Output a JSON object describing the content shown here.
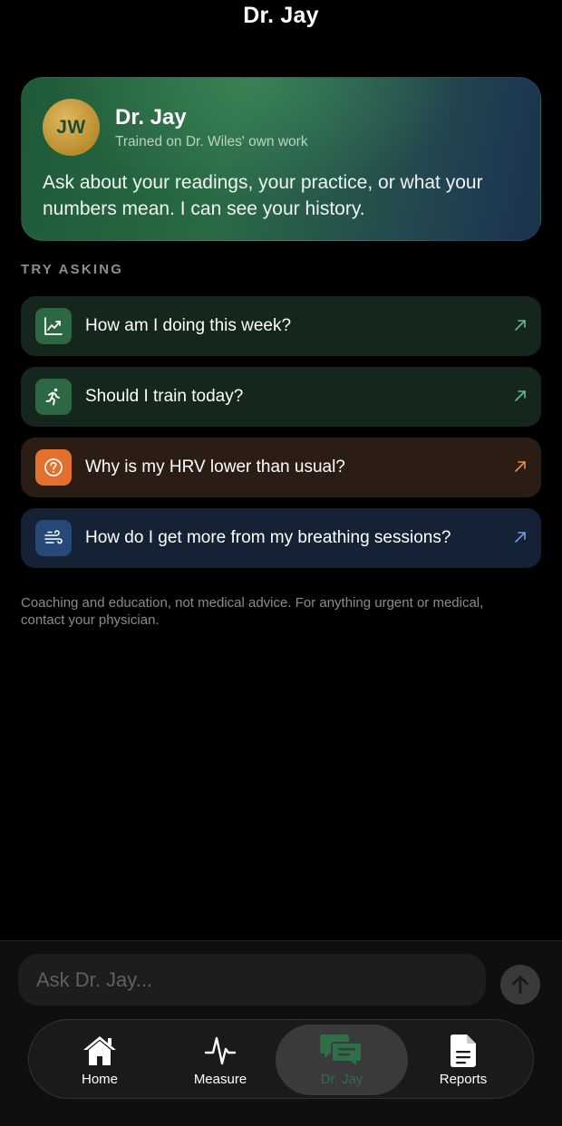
{
  "header": {
    "title": "Dr. Jay"
  },
  "hero": {
    "avatar_initials": "JW",
    "name": "Dr. Jay",
    "subtitle": "Trained on Dr. Wiles' own work",
    "description": "Ask about your readings, your practice, or what your numbers mean. I can see your history."
  },
  "suggestions": {
    "section_label": "TRY ASKING",
    "items": [
      {
        "label": "How am I doing this week?",
        "icon": "trend-chart-icon",
        "theme": "green",
        "accent": "#5bbf86"
      },
      {
        "label": "Should I train today?",
        "icon": "running-figure-icon",
        "theme": "green",
        "accent": "#5bbf86"
      },
      {
        "label": "Why is my HRV lower than usual?",
        "icon": "question-circle-icon",
        "theme": "orange",
        "accent": "#f08a4b"
      },
      {
        "label": "How do I get more from my breathing sessions?",
        "icon": "wind-icon",
        "theme": "blue",
        "accent": "#6f9fe0"
      }
    ]
  },
  "disclaimer": "Coaching and education, not medical advice. For anything urgent or medical, contact your physician.",
  "composer": {
    "placeholder": "Ask Dr. Jay..."
  },
  "tabbar": {
    "tabs": [
      {
        "label": "Home",
        "icon": "house-icon",
        "active": false
      },
      {
        "label": "Measure",
        "icon": "heartbeat-icon",
        "active": false
      },
      {
        "label": "Dr. Jay",
        "icon": "chat-bubbles-icon",
        "active": true
      },
      {
        "label": "Reports",
        "icon": "document-icon",
        "active": false
      }
    ]
  },
  "colors": {
    "background": "#000000",
    "accent_green": "#2f6e48",
    "accent_orange": "#e2712d",
    "accent_blue": "#274977",
    "avatar_gold": "#c99a3a"
  }
}
